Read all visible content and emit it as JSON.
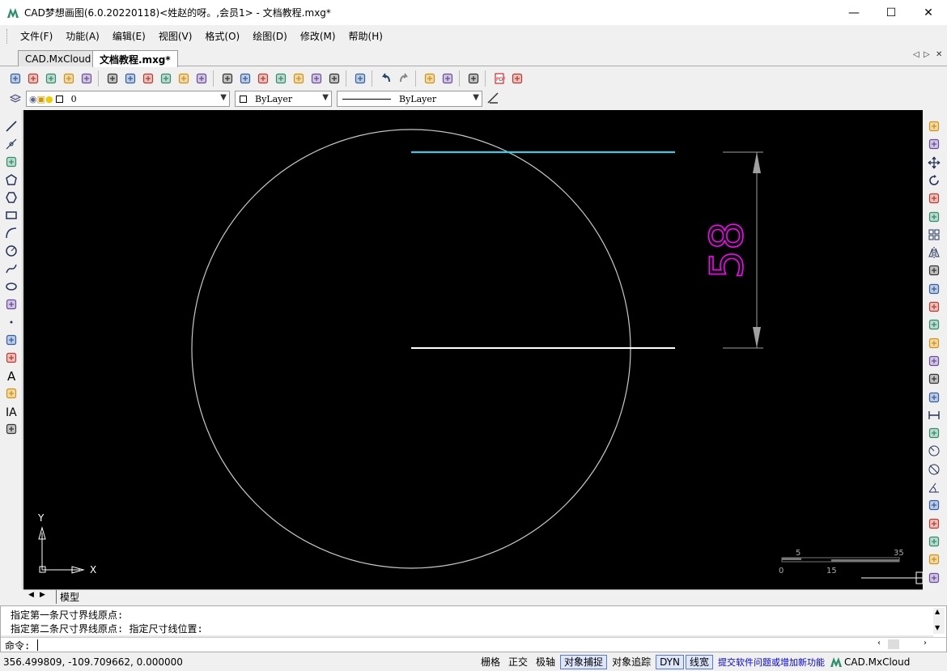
{
  "window": {
    "title": "CAD梦想画图(6.0.20220118)<姓赵的呀。,会员1> - 文档教程.mxg*",
    "controls": {
      "minimize": "—",
      "maximize": "☐",
      "close": "✕"
    }
  },
  "menu": [
    {
      "label": "文件(F)"
    },
    {
      "label": "功能(A)"
    },
    {
      "label": "编辑(E)"
    },
    {
      "label": "视图(V)"
    },
    {
      "label": "格式(O)"
    },
    {
      "label": "绘图(D)"
    },
    {
      "label": "修改(M)"
    },
    {
      "label": "帮助(H)"
    }
  ],
  "doc_tabs": [
    {
      "label": "CAD.MxCloud",
      "active": false
    },
    {
      "label": "文档教程.mxg*",
      "active": true
    }
  ],
  "tab_nav": {
    "prev": "◁",
    "next": "▷",
    "close": "✕"
  },
  "layer_bar": {
    "layer_value": "0",
    "color_value": "ByLayer",
    "linetype_value": "ByLayer"
  },
  "drawing": {
    "dimension_text": "58",
    "colors": {
      "background": "#000000",
      "circle": "#c8c8c8",
      "cyan_line": "#00e5ff",
      "white_line": "#ffffff",
      "dimension_lines": "#a0a0a0",
      "dimension_text": "#ff00ff"
    },
    "ucs": {
      "x_label": "X",
      "y_label": "Y"
    },
    "scale_bar": {
      "labels_top": [
        "5",
        "35"
      ],
      "labels_bottom": [
        "0",
        "15"
      ]
    }
  },
  "model_tab": {
    "label": "模型"
  },
  "command": {
    "history": [
      "指定第一条尺寸界线原点:",
      "指定第二条尺寸界线原点:  指定尺寸线位置:"
    ],
    "prompt": "命令:"
  },
  "status": {
    "coordinates": "356.499809,  -109.709662,  0.000000",
    "toggles": [
      {
        "label": "栅格",
        "on": false
      },
      {
        "label": "正交",
        "on": false
      },
      {
        "label": "极轴",
        "on": false
      },
      {
        "label": "对象捕捉",
        "on": true
      },
      {
        "label": "对象追踪",
        "on": false
      },
      {
        "label": "DYN",
        "on": true
      },
      {
        "label": "线宽",
        "on": true
      }
    ],
    "link": "提交软件问题或增加新功能",
    "brand": "CAD.MxCloud",
    "link_color": "#0000ee"
  },
  "icons": {
    "standard_toolbar": [
      "new-icon",
      "open-icon",
      "open-folder-icon",
      "save-icon",
      "save-all-icon",
      "zoom-realtime-icon",
      "zoom-window-icon",
      "zoom-extents-icon",
      "pan-icon",
      "ucs-icon",
      "zoom-all-icon",
      "find-icon",
      "pencil-icon",
      "layers-stack-icon",
      "text-style-icon",
      "external-icon",
      "palette-icon",
      "brush-icon",
      "book-icon",
      "undo-icon",
      "redo-icon",
      "print-icon",
      "render-icon",
      "cloud-icon",
      "pdf-icon",
      "image-icon"
    ],
    "left_draw": [
      "line-icon",
      "xline-icon",
      "polyline-icon",
      "polygon-icon",
      "polygon2-icon",
      "rectangle-icon",
      "arc-icon",
      "circle-icon",
      "spline-icon",
      "ellipse-icon",
      "revcloud-icon",
      "point-icon",
      "insert-block-icon",
      "make-block-icon",
      "text-icon",
      "hatch-icon",
      "mtext-icon",
      "table-icon"
    ],
    "right_modify": [
      "erase-icon",
      "copy-icon",
      "move-icon",
      "rotate-icon",
      "scale-icon",
      "offset-icon",
      "array-icon",
      "mirror-icon",
      "stretch-icon",
      "fillet-icon",
      "chamfer-icon",
      "trim-icon",
      "extend-icon",
      "explode-icon",
      "break-icon",
      "join-icon",
      "dim-linear-icon",
      "dim-aligned-icon",
      "dim-radius-icon",
      "dim-diameter-icon",
      "dim-angular-icon",
      "dim-baseline-icon",
      "layer-front-icon",
      "layer-back-icon",
      "layer-above-icon",
      "layer-below-icon"
    ]
  }
}
